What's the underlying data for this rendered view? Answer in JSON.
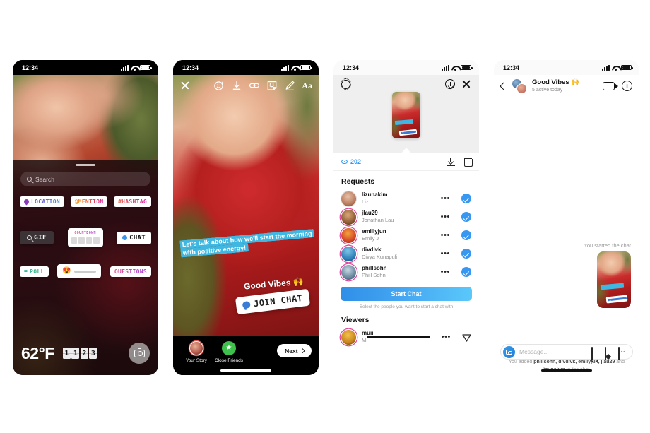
{
  "status_bar": {
    "time": "12:34",
    "signal_icon": "cellular-bars-icon",
    "wifi_icon": "wifi-icon",
    "battery_icon": "battery-icon"
  },
  "phone1": {
    "name": "story-sticker-tray",
    "search": {
      "placeholder": "Search",
      "icon": "search-icon"
    },
    "stickers_row1": [
      {
        "label": "LOCATION",
        "style": "location",
        "icon": "location-pin-icon"
      },
      {
        "label": "@MENTION",
        "style": "mention"
      },
      {
        "label": "#HASHTAG",
        "style": "hashtag"
      }
    ],
    "stickers_row2": {
      "gif": {
        "label": "GIF",
        "icon": "search-icon"
      },
      "countdown": {
        "label": "COUNTDOWN"
      },
      "chat": {
        "label": "CHAT",
        "icon": "chat-dot-icon"
      }
    },
    "stickers_row3": {
      "poll": {
        "label": "POLL",
        "icon": "poll-icon"
      },
      "emoji_slider": {
        "emoji": "😍"
      },
      "questions": {
        "label": "QUESTIONS"
      }
    },
    "bottom": {
      "temperature": "62°F",
      "time_digits": [
        "1",
        "1",
        "2",
        "3"
      ],
      "camera_icon": "camera-icon"
    }
  },
  "phone2": {
    "name": "story-editor",
    "toolbar": [
      {
        "icon": "close-icon",
        "name": "close"
      },
      {
        "icon": "effects-face-icon",
        "name": "effects"
      },
      {
        "icon": "download-icon",
        "name": "save"
      },
      {
        "icon": "link-icon",
        "name": "link"
      },
      {
        "icon": "sticker-icon",
        "name": "sticker"
      },
      {
        "icon": "draw-pencil-icon",
        "name": "draw"
      },
      {
        "icon": "text-aa-icon",
        "name": "text",
        "label": "Aa"
      }
    ],
    "text_sticker": "Let's talk about how we'll start the morning with positive energy!",
    "good_vibes": "Good Vibes 🙌",
    "join_chat": {
      "label": "JOIN CHAT",
      "icon": "chat-bubble-icon"
    },
    "share_options": [
      {
        "label": "Your Story",
        "icon": "your-story-avatar"
      },
      {
        "label": "Close Friends",
        "icon": "close-friends-star-icon"
      }
    ],
    "next_button": {
      "label": "Next",
      "icon": "chevron-right-icon"
    }
  },
  "phone3": {
    "name": "story-insights-and-requests",
    "top_icons": {
      "settings": "gear-icon",
      "download": "download-circle-icon",
      "close": "close-icon"
    },
    "stats": {
      "views": "202",
      "views_icon": "eye-icon",
      "download_icon": "download-icon",
      "delete_icon": "trash-icon"
    },
    "requests_title": "Requests",
    "requests": [
      {
        "username": "lizunakim",
        "fullname": "Liz",
        "more": "•••",
        "selected": true
      },
      {
        "username": "jlau29",
        "fullname": "Jonathan Lau",
        "more": "•••",
        "selected": true
      },
      {
        "username": "emillyjun",
        "fullname": "Emily J",
        "more": "•••",
        "selected": true
      },
      {
        "username": "divdivk",
        "fullname": "Divya Kunapuli",
        "more": "•••",
        "selected": true
      },
      {
        "username": "phillsohn",
        "fullname": "Phill Sohn",
        "more": "•••",
        "selected": true
      }
    ],
    "start_chat": {
      "label": "Start Chat",
      "hint": "Select the people you want to start a chat with"
    },
    "viewers_title": "Viewers",
    "viewers": [
      {
        "username": "muii",
        "fullname": "M.",
        "more": "•••",
        "send_icon": "send-icon"
      }
    ]
  },
  "phone4": {
    "name": "group-chat-thread",
    "header": {
      "back_icon": "back-chevron-icon",
      "title": "Good Vibes 🙌",
      "subtitle": "5 active today",
      "video_icon": "video-call-icon",
      "info_icon": "info-icon"
    },
    "thread": {
      "started_label": "You started the chat",
      "added_note_prefix": "You added ",
      "added_names": "phillsohn, divdivk, emilyjun, jlau29",
      "added_and": " and ",
      "added_last": "lizunakim",
      "added_suffix": " to the chat."
    },
    "composer": {
      "camera_icon": "camera-icon",
      "placeholder": "Message...",
      "mic_icon": "microphone-icon",
      "gallery_icon": "gallery-icon",
      "sticker_icon": "sticker-icon"
    }
  },
  "colors": {
    "accent_blue": "#3897f0",
    "gradient_start": "#2f8fe8",
    "gradient_end": "#5ac8fa",
    "sticker_cyan": "#3fb7e0",
    "muted": "#8e8e8e"
  }
}
